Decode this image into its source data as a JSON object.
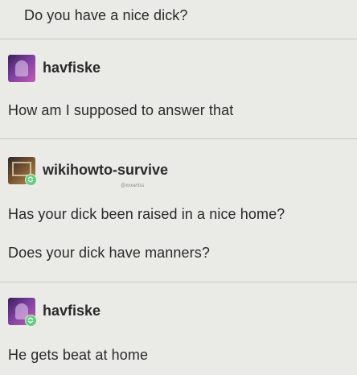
{
  "post0": {
    "text": "Do you have a nice dick?"
  },
  "post1": {
    "username": "havfiske",
    "avatar_icon": "avatar-purple-portrait",
    "text": "How am I supposed to answer that"
  },
  "post2": {
    "username": "wikihowto-survive",
    "avatar_icon": "avatar-framed-picture",
    "sublabel": "@xxxantss",
    "lines": [
      "Has your dick been raised in a nice home?",
      "Does your dick have manners?"
    ]
  },
  "post3": {
    "username": "havfiske",
    "avatar_icon": "avatar-purple-portrait",
    "text": "He gets beat at home"
  },
  "colors": {
    "background": "#eaeae6",
    "text": "#2a2a2a",
    "divider": "#c9c9c4",
    "reblog_badge": "#5fcf7a"
  }
}
